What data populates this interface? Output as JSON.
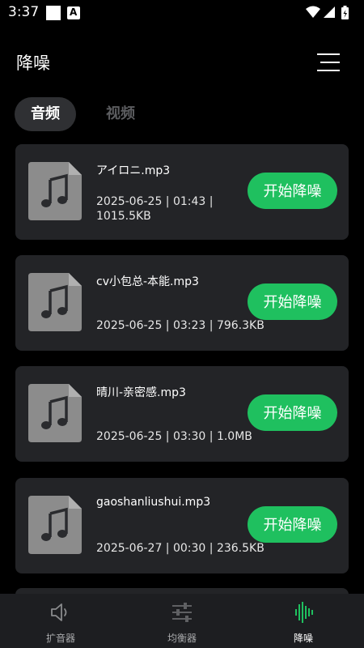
{
  "status_bar": {
    "time": "3:37"
  },
  "header": {
    "title": "降噪"
  },
  "tabs": [
    {
      "label": "音频",
      "active": true
    },
    {
      "label": "视频",
      "active": false
    }
  ],
  "files": [
    {
      "name": "アイロニ.mp3",
      "meta_line1": "2025-06-25 | 01:43 |",
      "meta_line2": "1015.5KB",
      "button": "开始降噪"
    },
    {
      "name": "cv小包总-本能.mp3",
      "meta": "2025-06-25 | 03:23 | 796.3KB",
      "button": "开始降噪"
    },
    {
      "name": "晴川-亲密感.mp3",
      "meta": "2025-06-25 | 03:30 | 1.0MB",
      "button": "开始降噪"
    },
    {
      "name": "gaoshanliushui.mp3",
      "meta": "2025-06-27 | 00:30 | 236.5KB",
      "button": "开始降噪"
    }
  ],
  "bottom_nav": [
    {
      "label": "扩音器",
      "icon": "speaker-icon",
      "active": false
    },
    {
      "label": "均衡器",
      "icon": "equalizer-icon",
      "active": false
    },
    {
      "label": "降噪",
      "icon": "waveform-icon",
      "active": true
    }
  ],
  "colors": {
    "background": "#000000",
    "card": "#232427",
    "accent_green": "#1fc05f",
    "nav_background": "#1d1e21"
  }
}
